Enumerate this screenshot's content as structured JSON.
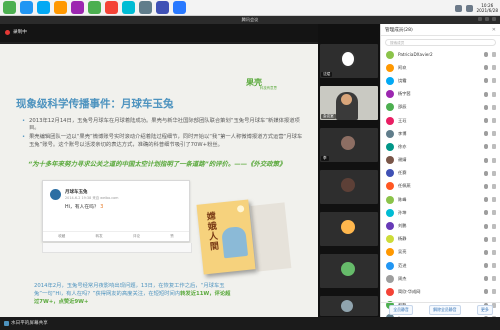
{
  "meeting_window": {
    "title": "腾讯会议"
  },
  "recording": {
    "label": "录制中"
  },
  "clock": {
    "time": "10:26",
    "date": "2021/6/28"
  },
  "tray": {
    "popup": "立即录制 · 分享屏"
  },
  "slide": {
    "logo_main": "果壳",
    "logo_sub": "科技有意思",
    "headline": "现象级科学传播事件：月球车玉兔",
    "bullets": [
      "2013年12月14日，玉兔号月球车在月球着陆成功。果壳与新华社国际部团队联合策划“玉兔号月球车”新媒体报道项目。",
      "果壳编辑团队一边以“果壳”微博账号实时滚动介绍着陆过程细节，同时开始以“我”第一人称微博报道方式运营“月球车玉兔”账号。这个账号以活泼亲切的表达方式，准确的科普细节吸引了70W+粉丝。"
    ],
    "quote": "“为十多年来努力寻求公关之道的中国太空计划指明了一条道路”的评价。——《外交政策》",
    "weibo_name": "月球车玉兔",
    "weibo_meta": "2014-6-2 19:38  来自 weibo.com",
    "weibo_text": "Hi，有人在吗？",
    "weibo_count": "3",
    "weibo_actions": [
      "收藏",
      "转发",
      "评论",
      "赞"
    ],
    "book_title": "嫦娥人間",
    "para_lead": "2014年2月，玉兔号经常月夜影响出现问题，13日，在恢复工作之后，“月球车玉兔”一句“Hi，有人在吗？”获得网友的高度关注，在短短时间内",
    "para_hl1": "转发近11W，评论超过7W+，",
    "para_hl2": "点赞近9W+"
  },
  "bottom": {
    "label": "水日平的屏幕共享"
  },
  "video_tiles": [
    {
      "name": "沈斌"
    },
    {
      "name": "会议室"
    },
    {
      "name": "李"
    },
    {
      "name": ""
    },
    {
      "name": ""
    },
    {
      "name": ""
    },
    {
      "name": ""
    },
    {
      "name": ""
    }
  ],
  "panel": {
    "title": "管理成员(28)",
    "search_placeholder": "搜索成员",
    "members": [
      {
        "name": "PatriciaDXavier2",
        "color": "#8bc34a"
      },
      {
        "name": "阿玖",
        "color": "#ff9800"
      },
      {
        "name": "饶霜",
        "color": "#03a9f4"
      },
      {
        "name": "杨宇茜",
        "color": "#9c27b0"
      },
      {
        "name": "邵辰",
        "color": "#4caf50"
      },
      {
        "name": "王珏",
        "color": "#e91e63"
      },
      {
        "name": "李博",
        "color": "#607d8b"
      },
      {
        "name": "徐亦",
        "color": "#009688"
      },
      {
        "name": "谢婧",
        "color": "#795548"
      },
      {
        "name": "任赛",
        "color": "#3f51b5"
      },
      {
        "name": "任佩燕",
        "color": "#ff5722"
      },
      {
        "name": "陈峰",
        "color": "#8bc34a"
      },
      {
        "name": "孙坤",
        "color": "#00bcd4"
      },
      {
        "name": "刘鹏",
        "color": "#673ab7"
      },
      {
        "name": "杨静",
        "color": "#cddc39"
      },
      {
        "name": "吴亮",
        "color": "#ff9800"
      },
      {
        "name": "范进",
        "color": "#2196f3"
      },
      {
        "name": "周杰",
        "color": "#9e9e9e"
      },
      {
        "name": "简欣-华成网",
        "color": "#f44336"
      },
      {
        "name": "赵帆",
        "color": "#4caf50"
      },
      {
        "name": "live",
        "color": "#607d8b"
      }
    ],
    "footer_buttons": [
      "全员静音",
      "解除全员静音",
      "更多"
    ]
  }
}
